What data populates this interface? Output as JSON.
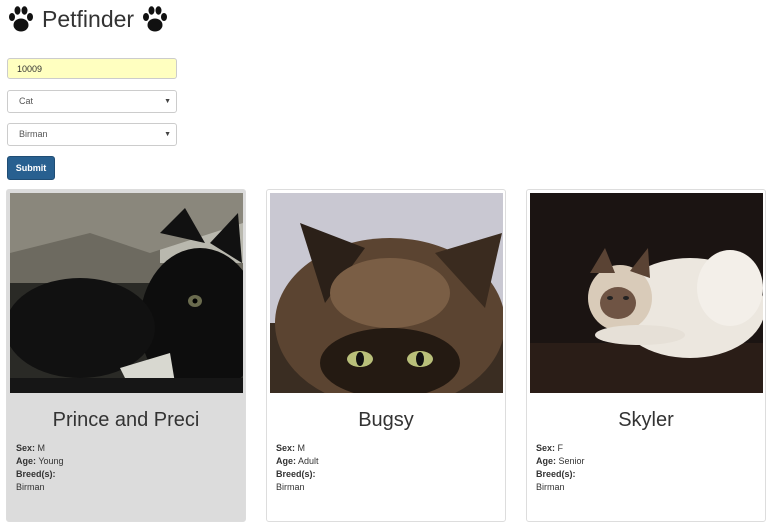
{
  "header": {
    "title": "Petfinder"
  },
  "form": {
    "zip_value": "10009",
    "species_selected": "Cat",
    "breed_selected": "Birman",
    "submit_label": "Submit"
  },
  "labels": {
    "sex": "Sex:",
    "age": "Age:",
    "breeds": "Breed(s):"
  },
  "pets": [
    {
      "name": "Prince and Preci",
      "sex": "M",
      "age": "Young",
      "breed": "Birman"
    },
    {
      "name": "Bugsy",
      "sex": "M",
      "age": "Adult",
      "breed": "Birman"
    },
    {
      "name": "Skyler",
      "sex": "F",
      "age": "Senior",
      "breed": "Birman"
    }
  ],
  "colors": {
    "submit": "#286090",
    "zip_background": "#ffffc0",
    "active_card": "#dcdcdc"
  }
}
